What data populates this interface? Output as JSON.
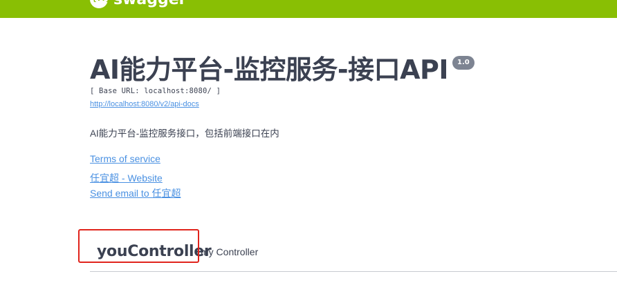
{
  "header": {
    "logo_text": "swagger",
    "background_color": "#89bf04"
  },
  "info": {
    "title": "AI能力平台-监控服务-接口API",
    "version": "1.0",
    "base_url": "[ Base URL: localhost:8080/ ]",
    "api_docs_url": "http://localhost:8080/v2/api-docs",
    "description": "AI能力平台-监控服务接口，包括前端接口在内",
    "terms_of_service": "Terms of service",
    "contact_website": "任宜超 - Website",
    "contact_email": "Send email to 任宜超"
  },
  "tags": [
    {
      "name": "youController",
      "description": "my Controller"
    }
  ],
  "annotation": {
    "highlight_color": "#e0231b"
  }
}
